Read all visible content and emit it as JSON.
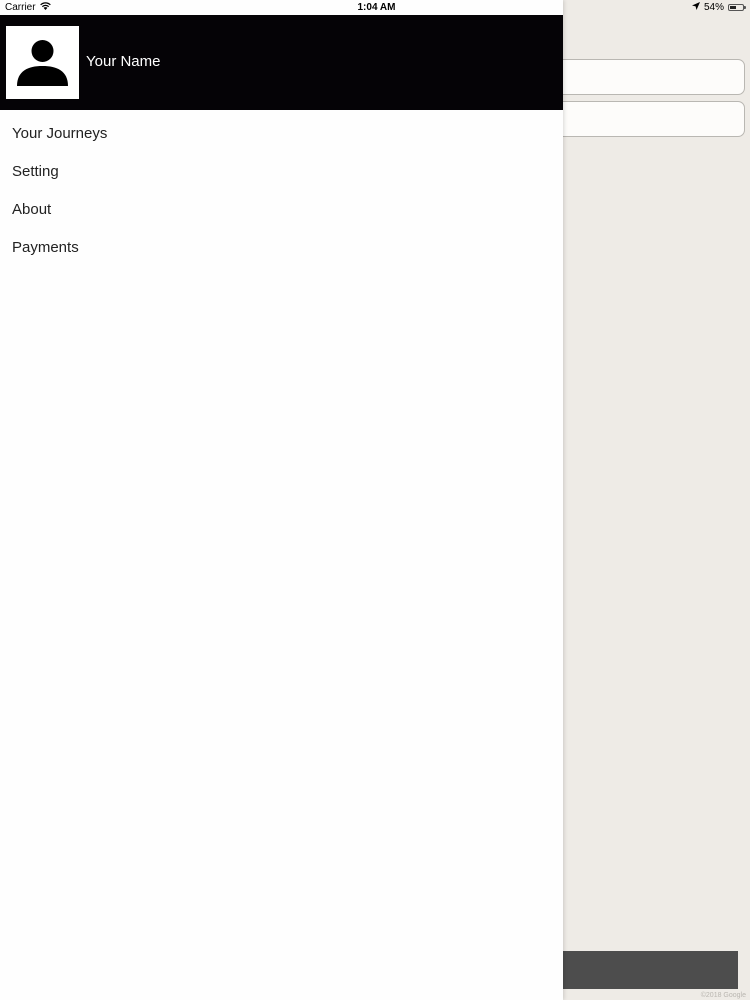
{
  "status_bar": {
    "carrier": "Carrier",
    "time": "1:04 AM",
    "battery": "54%",
    "battery_level": 0.54,
    "icons": [
      "wifi-icon",
      "location-arrow-icon",
      "battery-icon"
    ]
  },
  "drawer": {
    "user_name": "Your Name",
    "avatar_icon": "person-icon",
    "menu": [
      {
        "label": "Your Journeys"
      },
      {
        "label": "Setting"
      },
      {
        "label": "About"
      },
      {
        "label": "Payments"
      }
    ]
  },
  "background": {
    "watermark": "©2018 Google"
  },
  "colors": {
    "header_bg": "#050306",
    "drawer_bg": "#fefefe",
    "app_bg": "#eeebe6",
    "bottom_bar": "#4d4d4d"
  }
}
